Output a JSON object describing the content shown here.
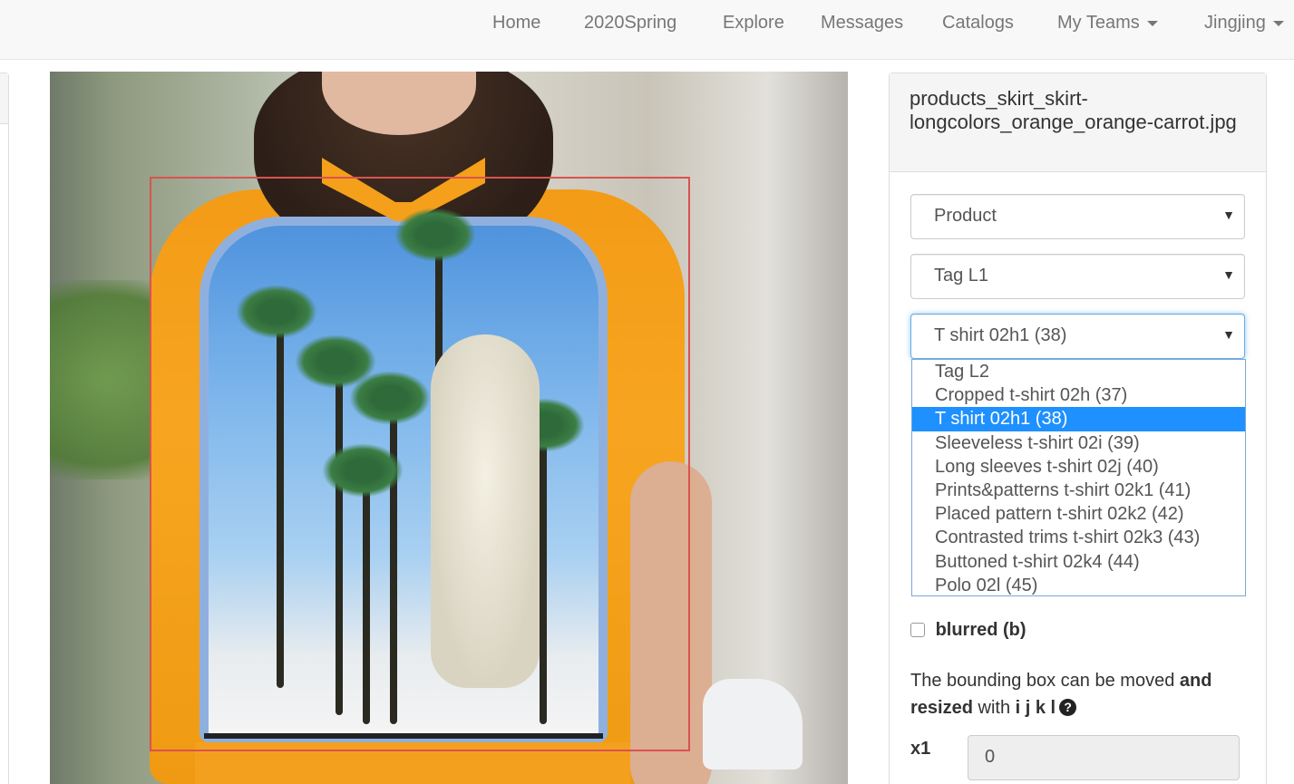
{
  "nav": {
    "items": [
      "Home",
      "2020Spring",
      "Explore",
      "Messages",
      "Catalogs"
    ],
    "teams_label": "My Teams",
    "user_label": "Jingjing"
  },
  "image_panel": {
    "filename": "products_skirt_skirt-longcolors_orange_orange-carrot.jpg"
  },
  "form": {
    "product_select": "Product",
    "tag_l1_select": "Tag L1",
    "tag_l2_select": "T shirt 02h1 (38)",
    "tag_l2_options": [
      "Tag L2",
      "Cropped t-shirt 02h (37)",
      "T shirt 02h1 (38)",
      "Sleeveless t-shirt 02i (39)",
      "Long sleeves t-shirt 02j (40)",
      "Prints&patterns t-shirt 02k1 (41)",
      "Placed pattern t-shirt 02k2 (42)",
      "Contrasted trims t-shirt 02k3 (43)",
      "Buttoned t-shirt 02k4 (44)",
      "Polo 02l (45)"
    ],
    "selected_option": "T shirt 02h1 (38)",
    "blurred_label": "blurred (b)",
    "blurred_checked": false,
    "hint_text_1": "The bounding box can be moved ",
    "hint_bold_1": "and resized",
    "hint_text_2": " with ",
    "hint_bold_2": "i j k l",
    "x1_label": "x1",
    "x1_value": "0"
  },
  "colors": {
    "bbox": "#d9534f",
    "selected_option_bg": "#1e90ff",
    "focus_border": "#66afe9"
  }
}
